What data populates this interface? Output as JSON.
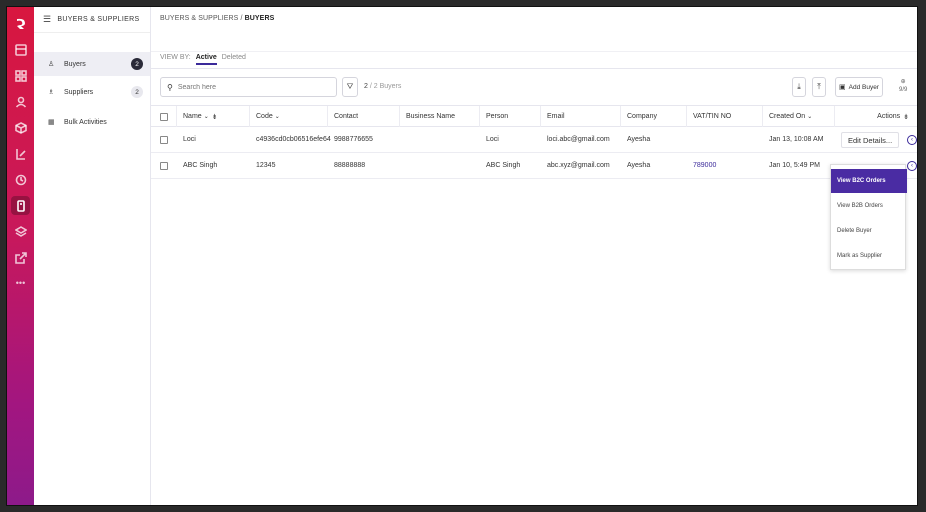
{
  "sidebar": {
    "title": "BUYERS & SUPPLIERS",
    "items": [
      {
        "label": "Buyers",
        "badge": "2"
      },
      {
        "label": "Suppliers",
        "badge": "2"
      },
      {
        "label": "Bulk Activities"
      }
    ]
  },
  "breadcrumb": {
    "parent": "BUYERS & SUPPLIERS",
    "separator": "/",
    "current": "BUYERS"
  },
  "view_by": {
    "label": "VIEW BY:",
    "active": "Active",
    "other": "Deleted"
  },
  "search": {
    "placeholder": "Search here",
    "value": ""
  },
  "count": {
    "shown": "2",
    "total": "/ 2 Buyers"
  },
  "toolbar": {
    "add_label": "Add Buyer",
    "columns": "9/9"
  },
  "table": {
    "headers": [
      "Name",
      "Code",
      "Contact",
      "Business Name",
      "Person",
      "Email",
      "Company",
      "VAT/TIN NO",
      "Created On",
      "Actions"
    ],
    "rows": [
      {
        "name": "Loci",
        "code": "c4936cd0cb06516efe64",
        "contact": "9988776655",
        "business": "",
        "person": "Loci",
        "email": "loci.abc@gmail.com",
        "company": "Ayesha",
        "vat": "",
        "created": "Jan 13, 10:08 AM",
        "action": "Edit Details..."
      },
      {
        "name": "ABC Singh",
        "code": "12345",
        "contact": "88888888",
        "business": "",
        "person": "ABC Singh",
        "email": "abc.xyz@gmail.com",
        "company": "Ayesha",
        "vat": "789000",
        "created": "Jan 10, 5:49 PM",
        "action": ""
      }
    ]
  },
  "actions_menu": [
    "View B2C Orders",
    "View B2B Orders",
    "Delete Buyer",
    "Mark as Supplier"
  ],
  "colors": {
    "accent": "#4a2ca3",
    "rail_top": "#d8173f",
    "rail_bottom": "#8d1a8a"
  }
}
